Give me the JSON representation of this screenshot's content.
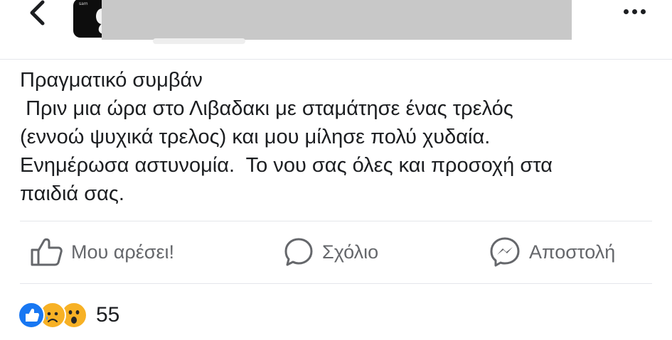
{
  "post": {
    "lines": [
      "Πραγματικό συμβάν",
      " Πριν μια ώρα στο Λιβαδακι με σταμάτησε ένας τρελός",
      "(εννοώ ψυχικά τρελος) και μου μίλησε πολύ χυδαία.",
      "Ενημέρωσα αστυνομία.  Το νου σας όλες και προσοχή στα",
      "παιδιά σας."
    ]
  },
  "actions": {
    "like_label": "Μου αρέσει!",
    "comment_label": "Σχόλιο",
    "send_label": "Αποστολή"
  },
  "reactions": {
    "types": [
      "like",
      "sad",
      "wow"
    ],
    "count": "55"
  },
  "icons": {
    "back": "chevron-left-icon",
    "more": "more-horizontal-icon",
    "like": "thumbs-up-icon",
    "comment": "comment-bubble-icon",
    "send": "messenger-icon"
  },
  "colors": {
    "text": "#1c1e21",
    "secondary_text": "#65676b",
    "like_blue": "#1877f2",
    "reaction_yellow": "#f7b125",
    "divider": "#e4e6eb",
    "redaction": "#c8c8c8"
  }
}
